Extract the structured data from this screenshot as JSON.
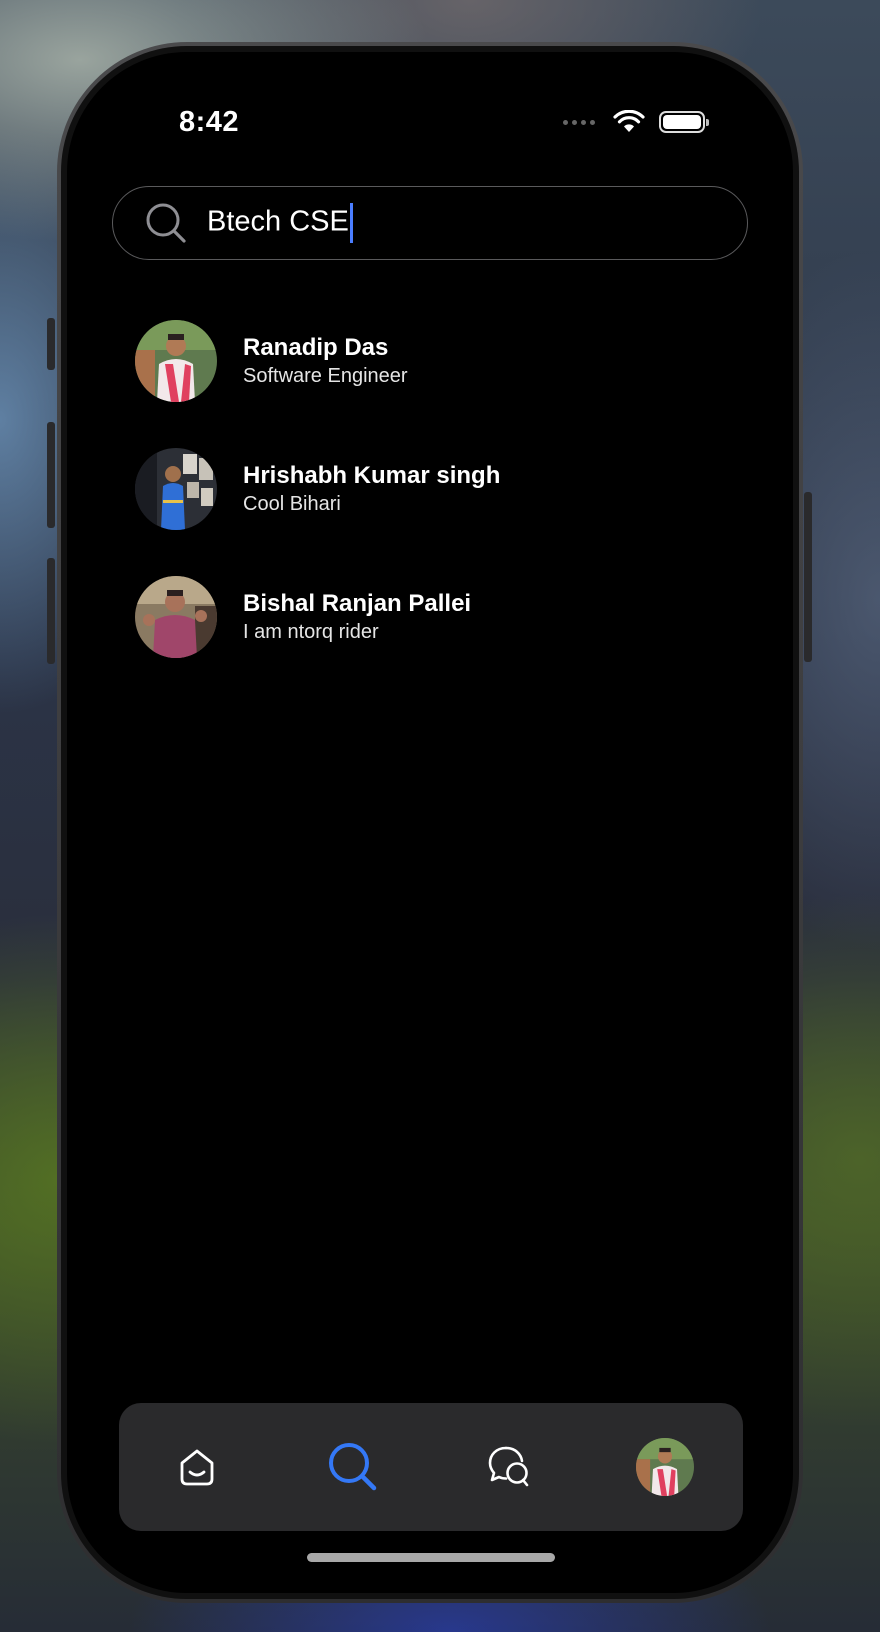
{
  "status_bar": {
    "time": "8:42"
  },
  "search": {
    "query": "Btech CSE"
  },
  "results": [
    {
      "name": "Ranadip Das",
      "subtitle": "Software Engineer",
      "avatar_icon": "person-photo"
    },
    {
      "name": "Hrishabh Kumar singh",
      "subtitle": "Cool Bihari",
      "avatar_icon": "person-photo"
    },
    {
      "name": "Bishal Ranjan Pallei",
      "subtitle": "I am ntorq rider",
      "avatar_icon": "person-photo"
    }
  ],
  "tab_bar": {
    "tabs": [
      {
        "icon": "home-icon",
        "active": false
      },
      {
        "icon": "search-icon",
        "active": true
      },
      {
        "icon": "chat-icon",
        "active": false
      },
      {
        "icon": "profile-avatar",
        "active": false
      }
    ]
  },
  "colors": {
    "accent": "#3478f6",
    "background": "#000000",
    "tab_bar": "#2a2a2c"
  }
}
